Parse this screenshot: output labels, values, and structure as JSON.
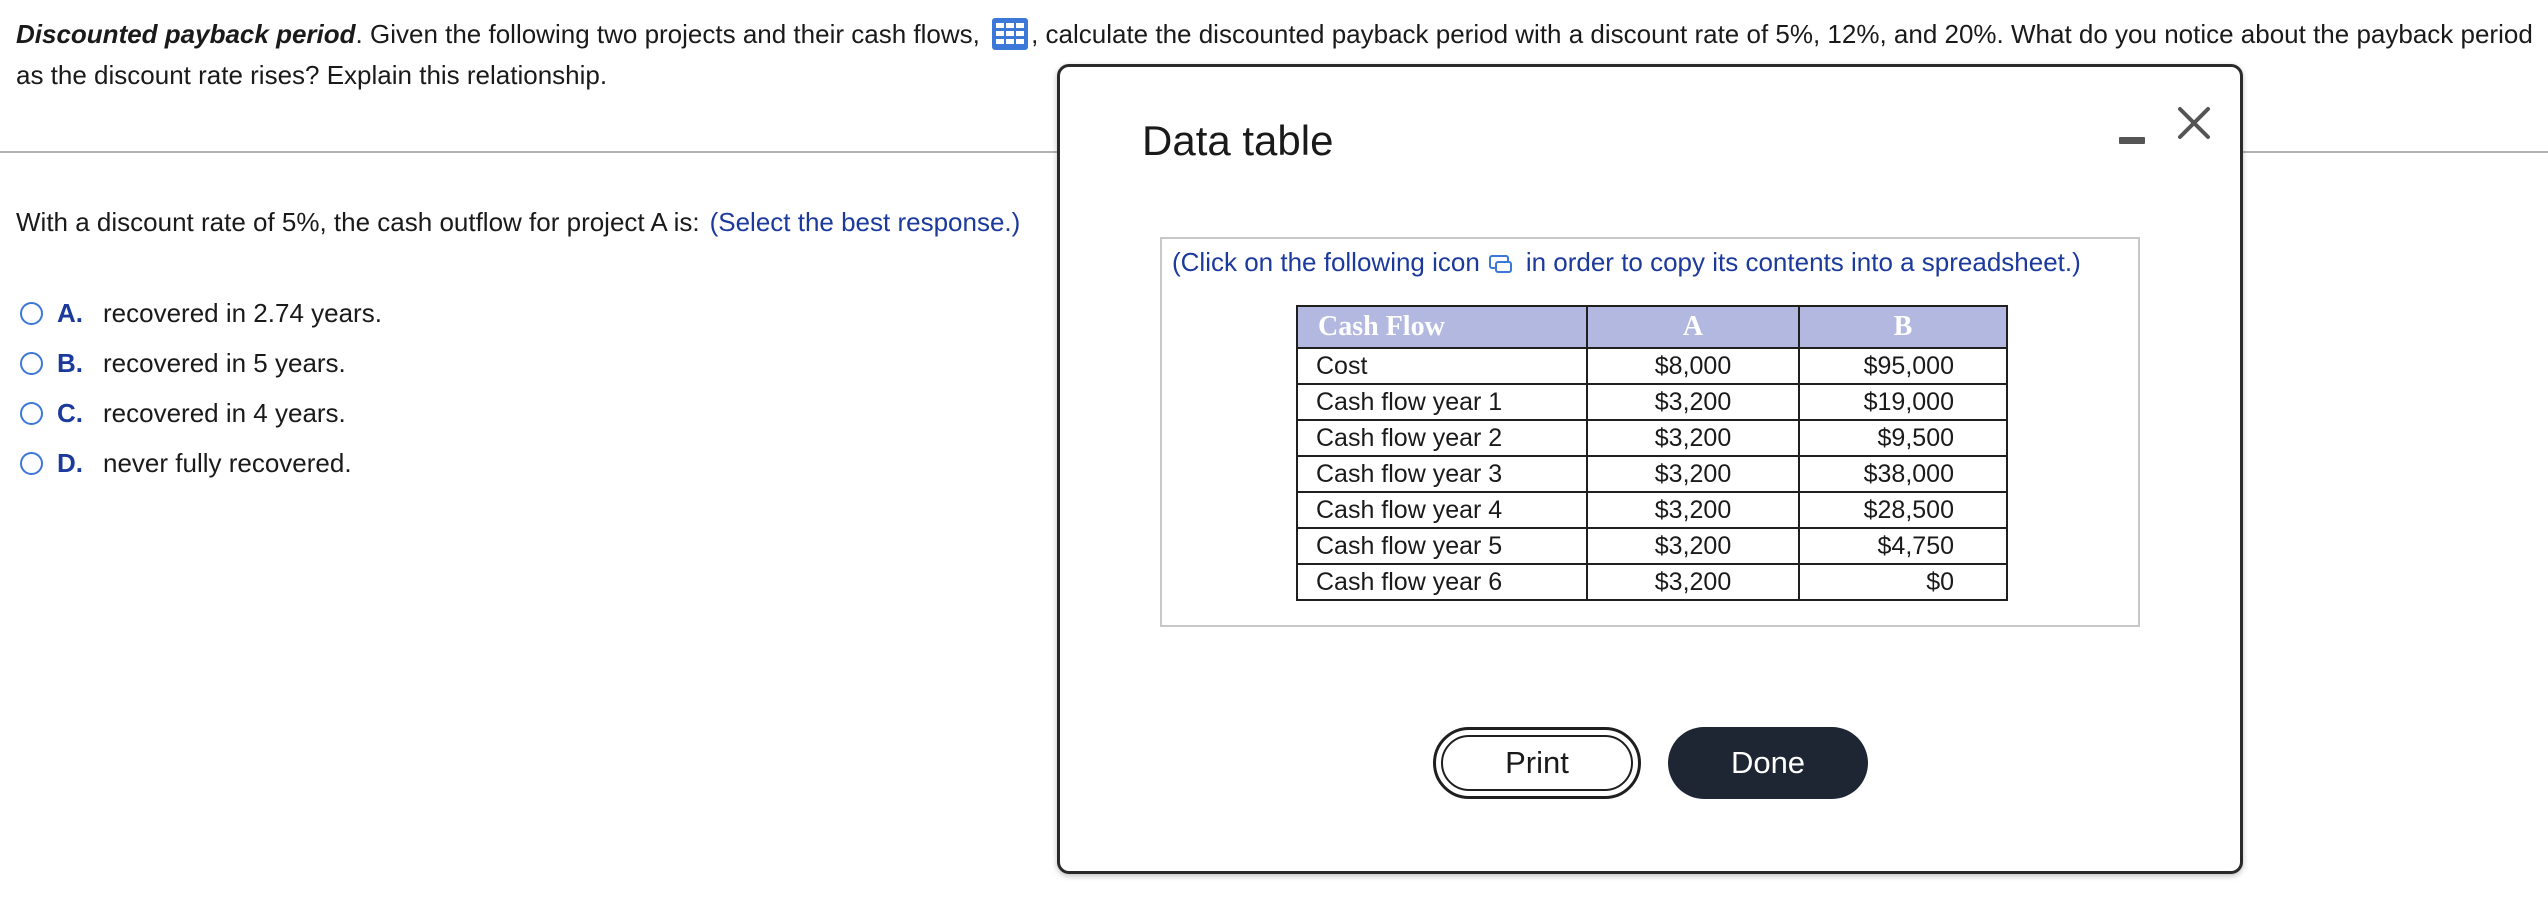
{
  "question": {
    "title": "Discounted payback period",
    "text_before_icon": ". Given the following two projects and their cash flows, ",
    "text_after_icon": ", calculate the discounted payback period with a discount rate of 5%, 12%, and 20%. What do you notice about the payback period as the discount rate rises? Explain this relationship.",
    "icon": "table-grid-icon"
  },
  "prompt": {
    "text": "With a discount rate of 5%, the cash outflow for project A is:",
    "hint": "(Select the best response.)"
  },
  "options": [
    {
      "letter": "A.",
      "text": "recovered in 2.74 years."
    },
    {
      "letter": "B.",
      "text": "recovered in 5 years."
    },
    {
      "letter": "C.",
      "text": "recovered in 4 years."
    },
    {
      "letter": "D.",
      "text": "never fully recovered."
    }
  ],
  "modal": {
    "title": "Data table",
    "copy_note_before": "(Click on the following icon",
    "copy_note_after": "in order to copy its contents into a spreadsheet.)",
    "table": {
      "headers": [
        "Cash Flow",
        "A",
        "B"
      ],
      "rows": [
        [
          "Cost",
          "$8,000",
          "$95,000"
        ],
        [
          "Cash flow year 1",
          "$3,200",
          "$19,000"
        ],
        [
          "Cash flow year 2",
          "$3,200",
          "$9,500"
        ],
        [
          "Cash flow year 3",
          "$3,200",
          "$38,000"
        ],
        [
          "Cash flow year 4",
          "$3,200",
          "$28,500"
        ],
        [
          "Cash flow year 5",
          "$3,200",
          "$4,750"
        ],
        [
          "Cash flow year 6",
          "$3,200",
          "$0"
        ]
      ]
    },
    "buttons": {
      "print": "Print",
      "done": "Done"
    }
  },
  "colors": {
    "link_blue": "#1b3a9c",
    "radio_blue": "#3c78d8",
    "table_header_bg": "#b3b8e0",
    "done_button_bg": "#1e2533"
  }
}
